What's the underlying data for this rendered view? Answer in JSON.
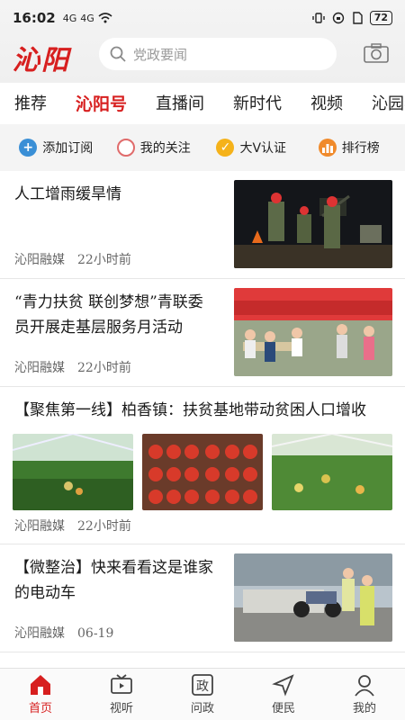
{
  "status": {
    "time": "16:02",
    "signal1": "4G",
    "signal2": "4G",
    "battery": "72"
  },
  "header": {
    "logo": "沁阳",
    "search_placeholder": "党政要闻"
  },
  "tabs": [
    {
      "label": "推荐"
    },
    {
      "label": "沁阳号",
      "active": true
    },
    {
      "label": "直播间"
    },
    {
      "label": "新时代"
    },
    {
      "label": "视频"
    },
    {
      "label": "沁园春"
    }
  ],
  "actions": [
    {
      "label": "添加订阅",
      "icon": "plus-icon",
      "color": "#3a8fd6"
    },
    {
      "label": "我的关注",
      "icon": "circle-icon",
      "color": "#e06b6b"
    },
    {
      "label": "大V认证",
      "icon": "check-icon",
      "color": "#f5b21a"
    },
    {
      "label": "排行榜",
      "icon": "bar-chart-icon",
      "color": "#f08a2b"
    }
  ],
  "feed": [
    {
      "title": "人工增雨缓旱情",
      "source": "沁阳融媒",
      "time": "22小时前"
    },
    {
      "title": "“青力扶贫 联创梦想”青联委员开展走基层服务月活动",
      "source": "沁阳融媒",
      "time": "22小时前"
    },
    {
      "title": "【聚焦第一线】柏香镇：扶贫基地带动贫困人口增收",
      "source": "沁阳融媒",
      "time": "22小时前"
    },
    {
      "title": "【微整治】快来看看这是谁家的电动车",
      "source": "沁阳融媒",
      "time": "06-19"
    }
  ],
  "bottom_nav": [
    {
      "label": "首页",
      "active": true
    },
    {
      "label": "视听"
    },
    {
      "label": "问政"
    },
    {
      "label": "便民"
    },
    {
      "label": "我的"
    }
  ],
  "colors": {
    "accent": "#d71f1f"
  }
}
